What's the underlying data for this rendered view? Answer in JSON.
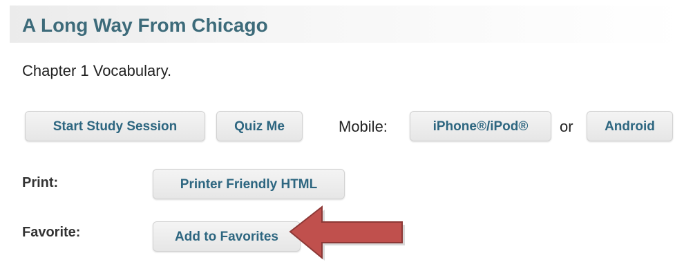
{
  "page": {
    "title": "A Long Way From Chicago",
    "description": "Chapter 1 Vocabulary."
  },
  "actions": {
    "start_study_label": "Start Study Session",
    "quiz_label": "Quiz Me"
  },
  "mobile": {
    "label": "Mobile:",
    "iphone_label": "iPhone®/iPod®",
    "or_text": "or",
    "android_label": "Android"
  },
  "print": {
    "label": "Print:",
    "button_label": "Printer Friendly HTML"
  },
  "favorite": {
    "label": "Favorite:",
    "button_label": "Add to Favorites"
  },
  "annotation": {
    "arrow_icon": "left-arrow-icon",
    "arrow_fill": "#c0504d",
    "arrow_outline": "#8c3836"
  },
  "colors": {
    "title": "#3d6b7a",
    "button_text": "#2d6680",
    "button_bg": "#ececec"
  }
}
